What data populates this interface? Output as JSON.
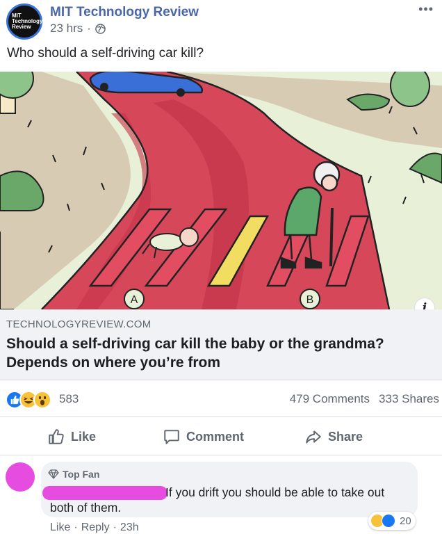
{
  "post": {
    "page_name": "MIT Technology Review",
    "avatar_text": "MIT Technology Review",
    "time": "23 hrs",
    "separator": "·",
    "more_label": "•••",
    "text": "Who should a self-driving car kill?"
  },
  "illustration": {
    "label_a": "A",
    "label_b": "B",
    "info_label": "i"
  },
  "link": {
    "domain": "TECHNOLOGYREVIEW.COM",
    "title": "Should a self-driving car kill the baby or the grandma? Depends on where you’re from"
  },
  "reactions": {
    "icons": [
      "like-icon",
      "haha-icon",
      "wow-icon"
    ],
    "count": "583",
    "comments": "479 Comments",
    "shares": "333 Shares"
  },
  "actions": {
    "like": "Like",
    "comment": "Comment",
    "share": "Share"
  },
  "comment": {
    "badge": "Top Fan",
    "text_line1": "If you drift you should be able to take out",
    "text_line2": "both of them.",
    "reaction_count": "20",
    "like_label": "Like",
    "reply_label": "Reply",
    "time": "23h",
    "separator": "·"
  },
  "colors": {
    "accent": "#4a66a8",
    "like_blue": "#1877f2",
    "redaction": "#e74ce0"
  }
}
